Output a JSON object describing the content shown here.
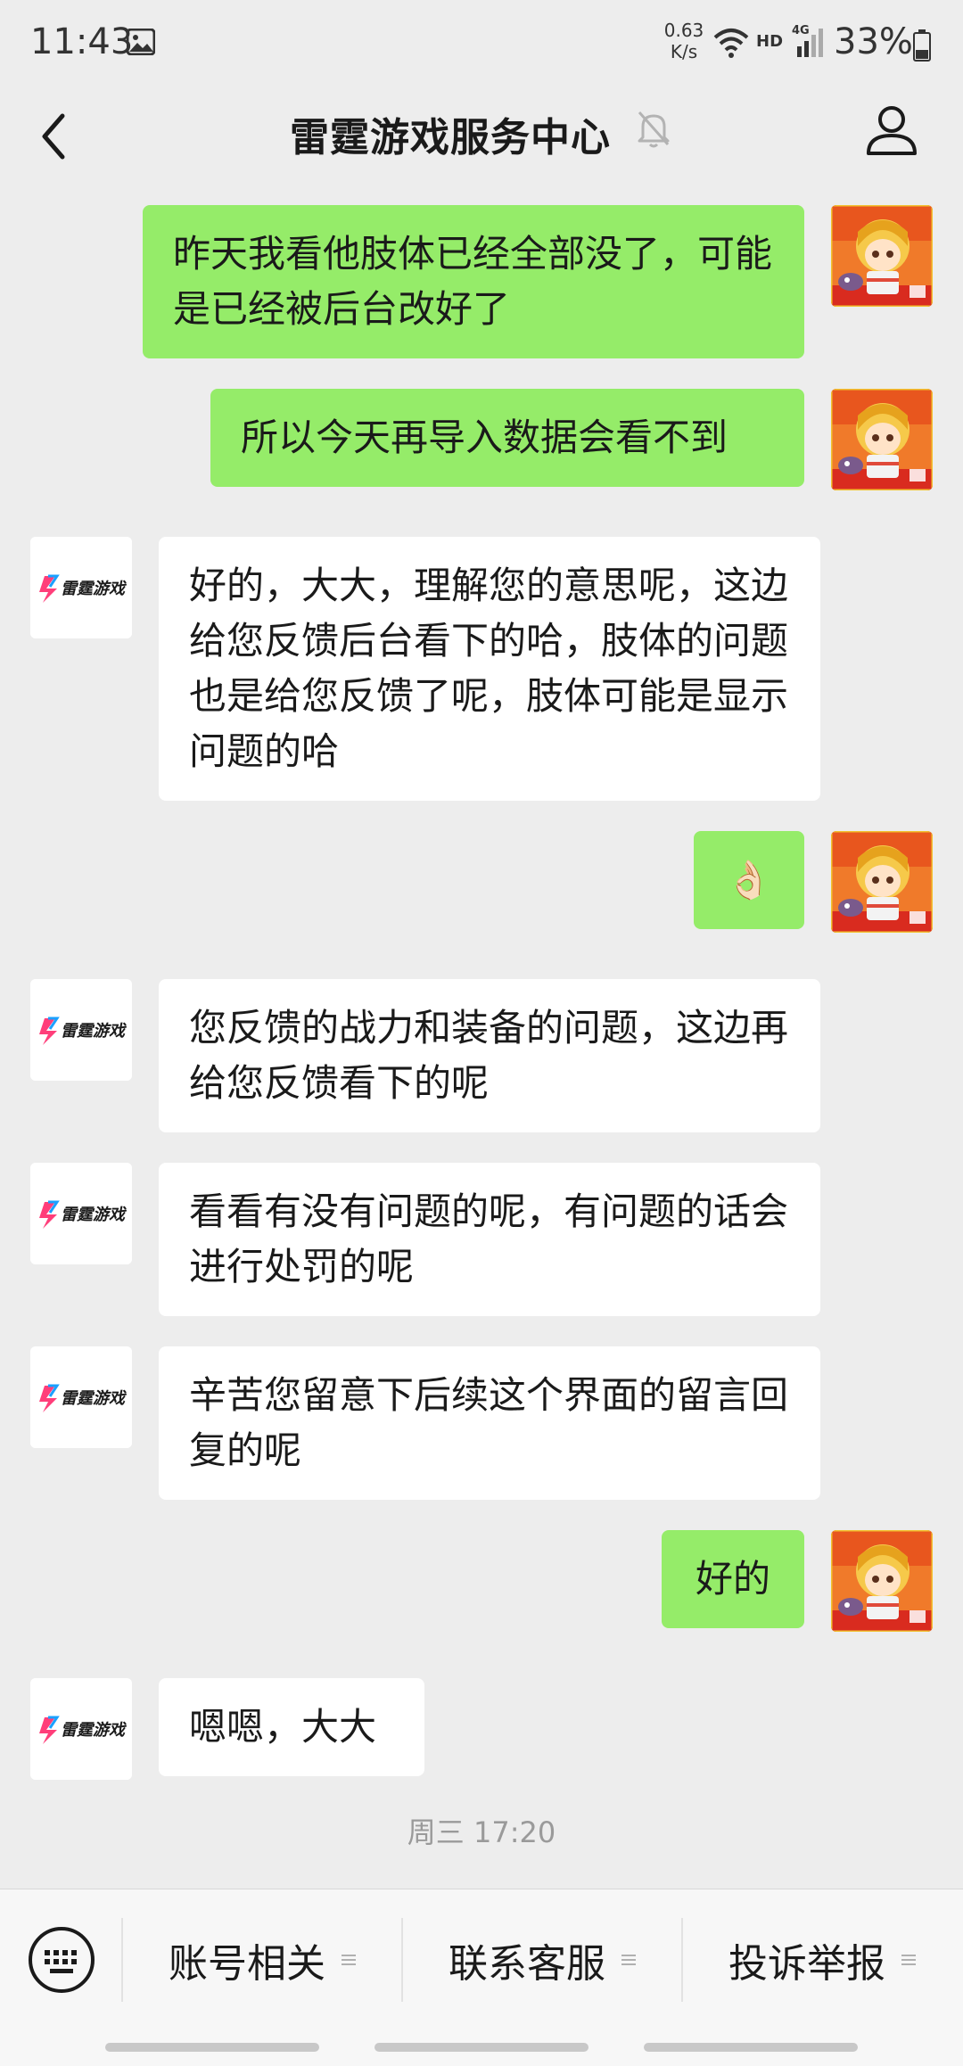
{
  "status_bar": {
    "time": "11:43",
    "net_speed_value": "0.63",
    "net_speed_unit": "K/s",
    "hd": "HD",
    "network": "4G",
    "battery": "33%"
  },
  "header": {
    "title": "雷霆游戏服务中心"
  },
  "logo": {
    "text": "雷霆游戏",
    "accent_colors": [
      "#ff3e7a",
      "#1aa0ff"
    ]
  },
  "messages": [
    {
      "side": "sent",
      "text": "昨天我看他肢体已经全部没了，可能是已经被后台改好了"
    },
    {
      "side": "sent",
      "text": "所以今天再导入数据会看不到"
    },
    {
      "side": "received",
      "text": "好的，大大，理解您的意思呢，这边给您反馈后台看下的哈，肢体的问题也是给您反馈了呢，肢体可能是显示问题的哈"
    },
    {
      "side": "sent",
      "text": "👌🏻"
    },
    {
      "side": "received",
      "text": "您反馈的战力和装备的问题，这边再给您反馈看下的呢"
    },
    {
      "side": "received",
      "text": "看看有没有问题的呢，有问题的话会进行处罚的呢"
    },
    {
      "side": "received",
      "text": "辛苦您留意下后续这个界面的留言回复的呢"
    },
    {
      "side": "sent",
      "text": "好的"
    },
    {
      "side": "received",
      "text": "嗯嗯，大大"
    }
  ],
  "timestamp": "周三 17:20",
  "menu": {
    "items": [
      "账号相关",
      "联系客服",
      "投诉举报"
    ]
  },
  "colors": {
    "sent_bubble": "#95ec69",
    "received_bubble": "#ffffff",
    "background": "#ededed"
  }
}
